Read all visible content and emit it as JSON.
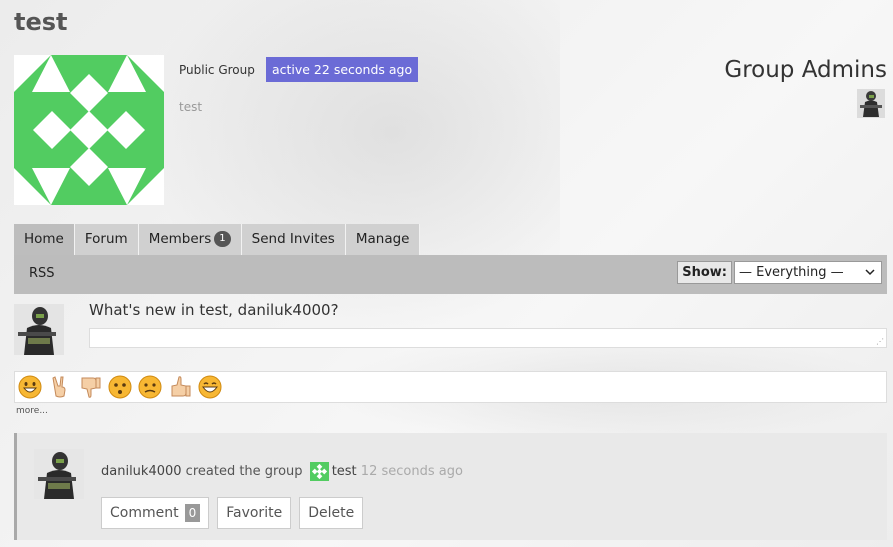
{
  "group": {
    "name": "test",
    "type_label": "Public Group",
    "activity_label": "active 22 seconds ago",
    "description": "test"
  },
  "admins": {
    "title": "Group Admins"
  },
  "tabs": [
    {
      "label": "Home",
      "active": true
    },
    {
      "label": "Forum"
    },
    {
      "label": "Members",
      "count": "1"
    },
    {
      "label": "Send Invites"
    },
    {
      "label": "Manage"
    }
  ],
  "subnav": {
    "rss_label": "RSS",
    "filter_label": "Show:",
    "filter_value": "— Everything —"
  },
  "post_form": {
    "prompt": "What's new in test, daniluk4000?"
  },
  "emoji_bar": {
    "icons": [
      "grinning-face",
      "victory-hand",
      "thumbs-down",
      "astonished-face",
      "confused-face",
      "thumbs-up",
      "grin-face"
    ],
    "more_label": "more..."
  },
  "activity": {
    "user": "daniluk4000",
    "action": " created the group ",
    "group_link": "test",
    "time": "12 seconds ago",
    "buttons": {
      "comment_label": "Comment",
      "comment_count": "0",
      "favorite_label": "Favorite",
      "delete_label": "Delete"
    }
  },
  "colors": {
    "group_avatar": "#52cc61",
    "activity_badge": "#6b6bd6"
  }
}
